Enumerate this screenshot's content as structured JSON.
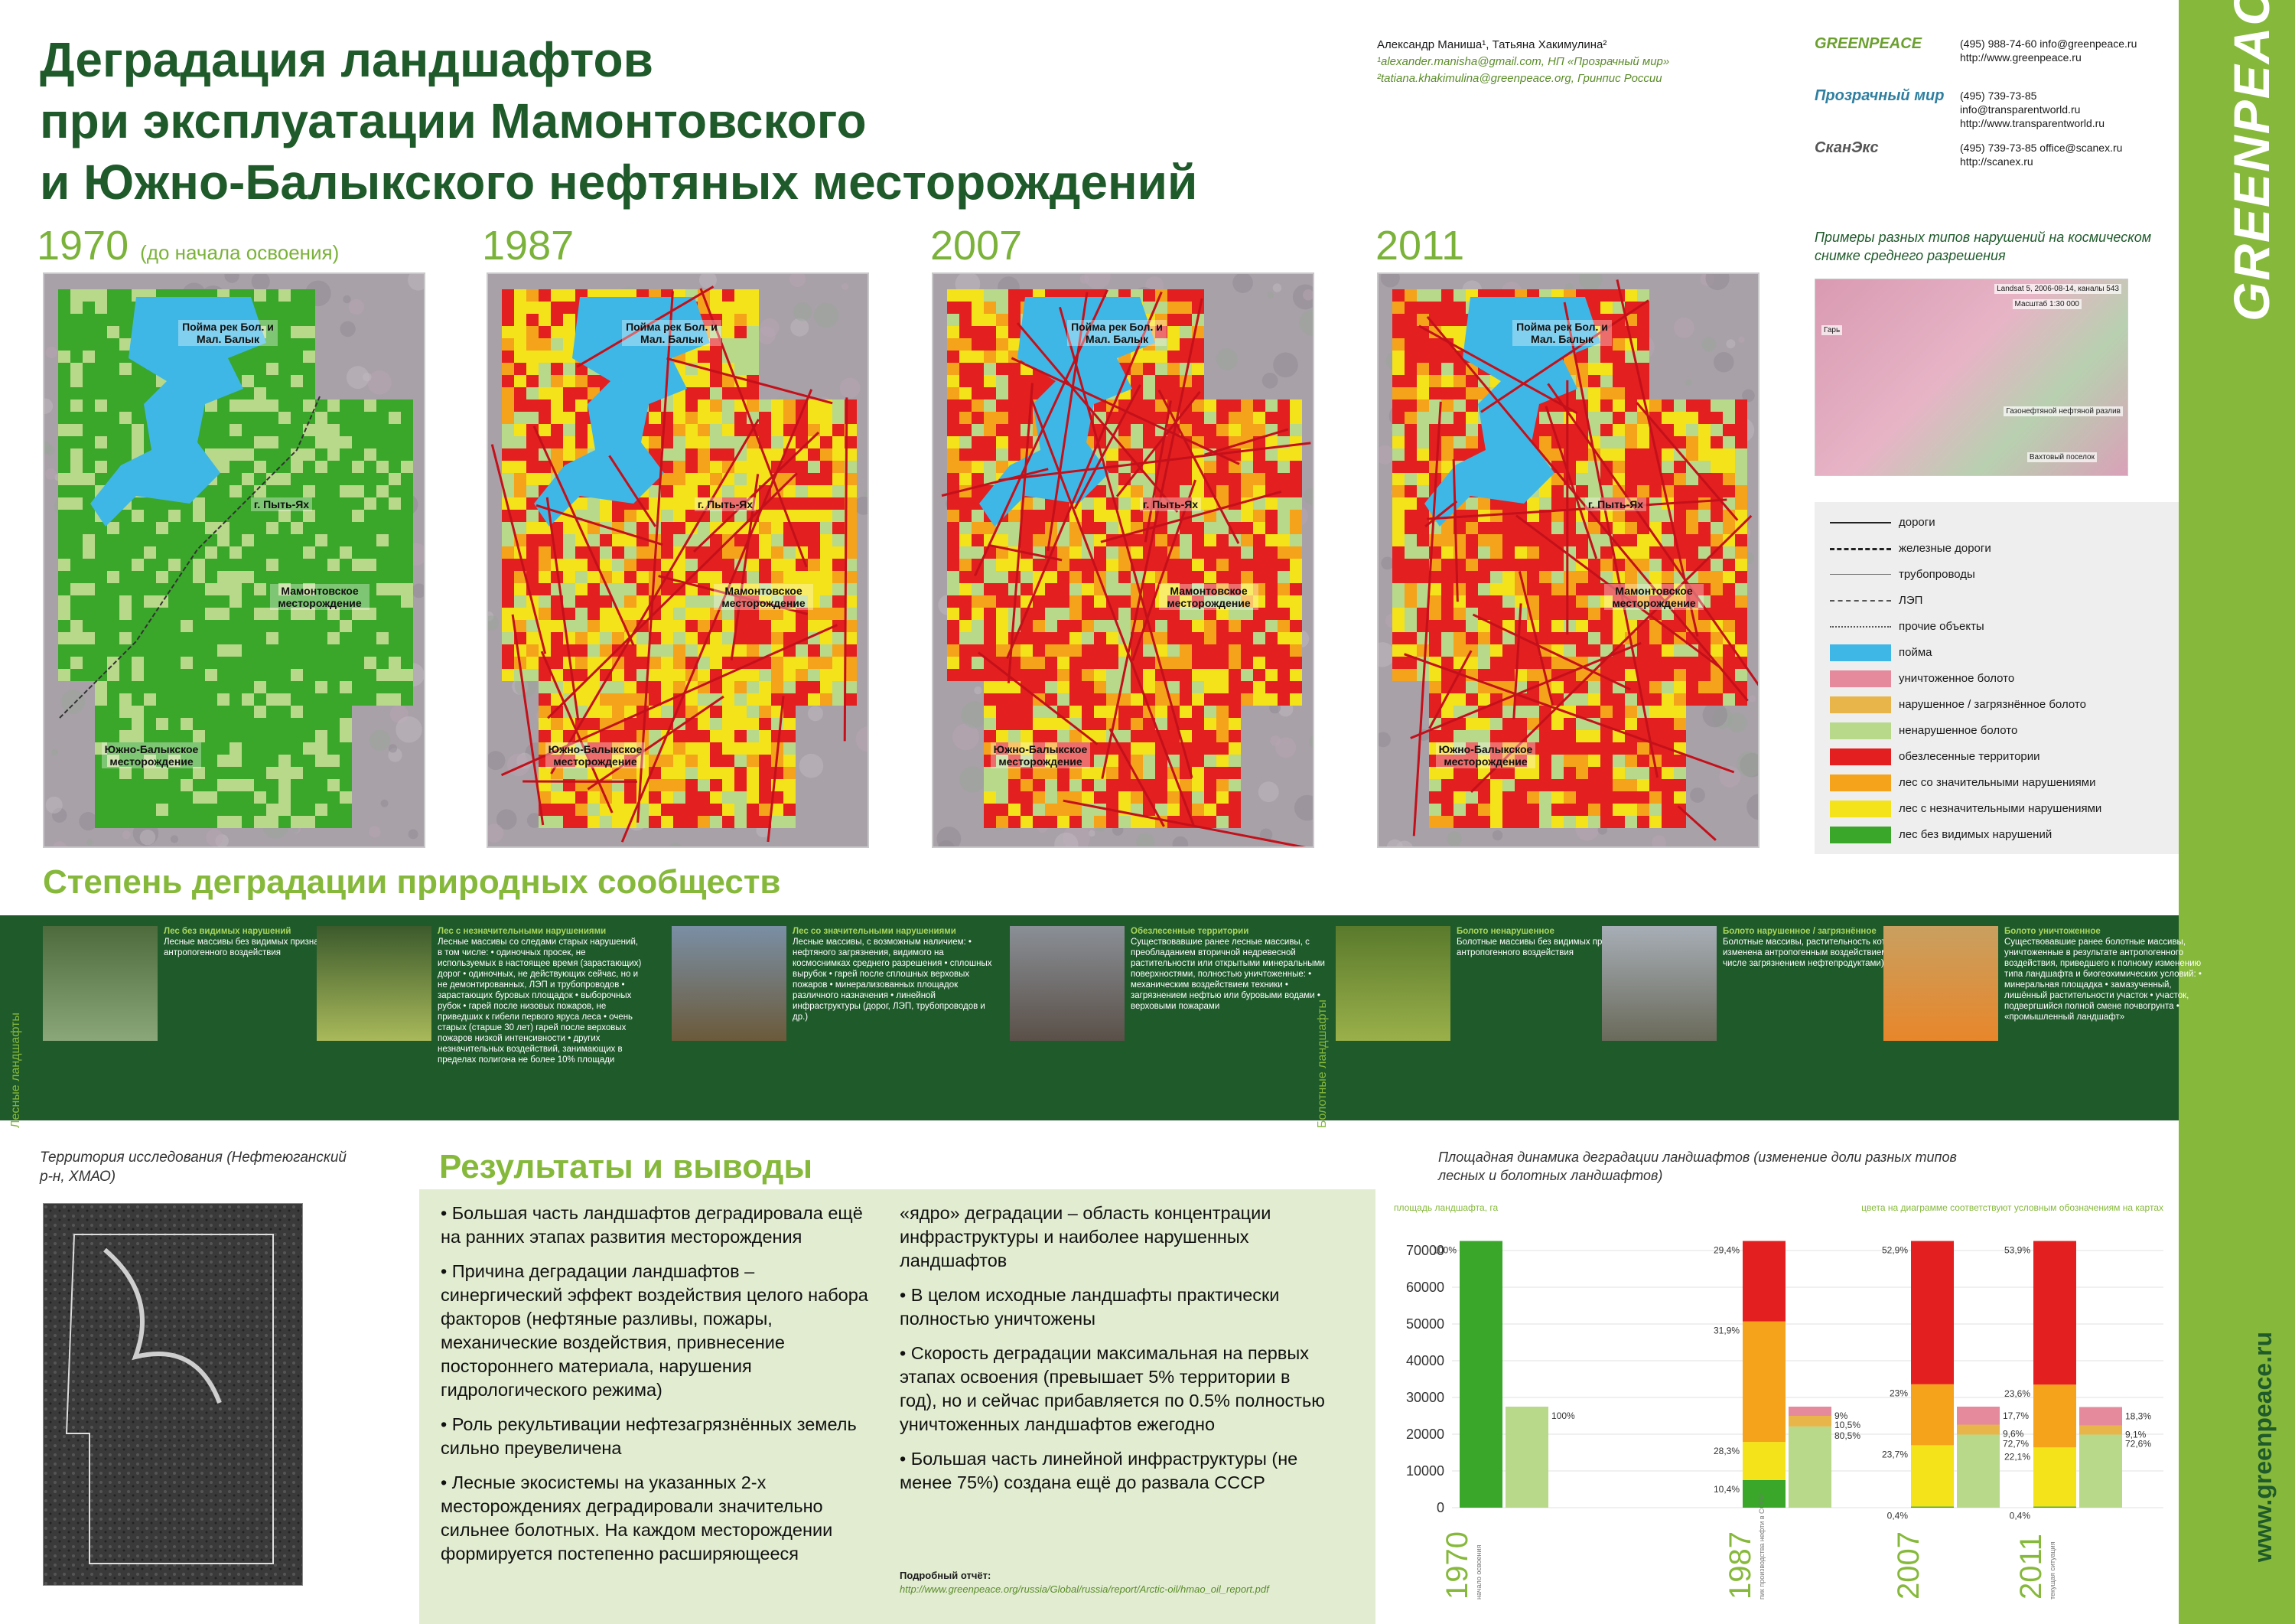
{
  "title_lines": [
    "Деградация ландшафтов",
    "при эксплуатации Мамонтовского",
    "и Южно-Балыкского нефтяных месторождений"
  ],
  "authors": {
    "names": "Александр Маниша¹, Татьяна Хакимулина²",
    "line1": "¹alexander.manisha@gmail.com, НП «Прозрачный мир»",
    "line2": "²tatiana.khakimulina@greenpeace.org, Гринпис России"
  },
  "contacts": [
    {
      "logo": "GREENPEACE",
      "lines": [
        "(495) 988-74-60   info@greenpeace.ru",
        "http://www.greenpeace.ru"
      ],
      "color": "#6ba02f"
    },
    {
      "logo": "Прозрачный мир",
      "lines": [
        "(495) 739-73-85",
        "info@transparentworld.ru",
        "http://www.transparentworld.ru"
      ],
      "color": "#2f7fa0"
    },
    {
      "logo": "СканЭкс",
      "lines": [
        "(495) 739-73-85   office@scanex.ru",
        "http://scanex.ru"
      ],
      "color": "#555555"
    }
  ],
  "side": {
    "brand": "GREENPEACE",
    "url": "www.greenpeace.ru"
  },
  "maps": [
    {
      "year": "1970",
      "note": "(до начала освоения)"
    },
    {
      "year": "1987",
      "note": ""
    },
    {
      "year": "2007",
      "note": ""
    },
    {
      "year": "2011",
      "note": ""
    }
  ],
  "map_labels": {
    "poyma": "Пойма рек Бол. и Мал. Балык",
    "pyt_yah": "г. Пыть-Ях",
    "mamont": "Мамонтовское месторождение",
    "yuzhno": "Южно-Балыкское месторождение"
  },
  "example": {
    "caption": "Примеры разных типов нарушений на космическом снимке среднего разрешения",
    "labels": [
      "Landsat 5, 2006-08-14, каналы 543",
      "Масштаб 1:30 000",
      "Гарь",
      "Газонефтяной нефтяной разлив",
      "Вахтовый поселок"
    ]
  },
  "legend": [
    {
      "type": "line",
      "style": "solid",
      "label": "дороги"
    },
    {
      "type": "line",
      "style": "rail",
      "label": "железные дороги"
    },
    {
      "type": "line",
      "style": "thin",
      "label": "трубопроводы"
    },
    {
      "type": "line",
      "style": "dashdot",
      "label": "ЛЭП"
    },
    {
      "type": "line",
      "style": "dotted",
      "label": "прочие объекты"
    },
    {
      "type": "fill",
      "color": "#3fb7e6",
      "label": "пойма"
    },
    {
      "type": "fill",
      "color": "#e58a9c",
      "label": "уничтоженное болото"
    },
    {
      "type": "fill",
      "color": "#e8b54a",
      "label": "нарушенное / загрязнённое болото"
    },
    {
      "type": "fill",
      "color": "#b8d88a",
      "label": "ненарушенное болото"
    },
    {
      "type": "fill",
      "color": "#e41f1f",
      "label": "обезлесенные территории"
    },
    {
      "type": "fill",
      "color": "#f4a31a",
      "label": "лес со значительными нарушениями"
    },
    {
      "type": "fill",
      "color": "#f4e21a",
      "label": "лес с незначительными нарушениями"
    },
    {
      "type": "fill",
      "color": "#3aa62a",
      "label": "лес без видимых нарушений"
    }
  ],
  "degradation_title": "Степень деградации природных сообществ",
  "band_groups": [
    "Лесные ландшафты",
    "Болотные ландшафты"
  ],
  "cards": [
    {
      "head": "Лес без видимых нарушений",
      "text": "Лесные массивы без видимых признаков антропогенного воздействия",
      "photo": [
        "#4d6b3c",
        "#8aa77a"
      ]
    },
    {
      "head": "Лес с незначительными нарушениями",
      "text": "Лесные массивы со следами старых нарушений, в том числе: • одиночных просек, не используемых в настоящее время (зарастающих) дорог • одиночных, не действующих сейчас, но и не демонтированных, ЛЭП и трубопроводов • зарастающих буровых площадок • выборочных рубок • гарей после низовых пожаров, не приведших к гибели первого яруса леса • очень старых (старше 30 лет) гарей после верховых пожаров низкой интенсивности • других незначительных воздействий, занимающих в пределах полигона не более 10% площади",
      "photo": [
        "#3c5a2c",
        "#a9b95a"
      ]
    },
    {
      "head": "Лес со значительными нарушениями",
      "text": "Лесные массивы, с возможным наличием: • нефтяного загрязнения, видимого на космоснимках среднего разрешения • сплошных вырубок • гарей после сплошных верховых пожаров • минерализованных площадок различного назначения • линейной инфраструктуры (дорог, ЛЭП, трубопроводов и др.)",
      "photo": [
        "#7a8fa5",
        "#6b5a3a"
      ]
    },
    {
      "head": "Обезлесенные территории",
      "text": "Существовавшие ранее лесные массивы, с преобладанием вторичной недревесной растительности или открытыми минеральными поверхностями, полностью уничтоженные: • механическим воздействием техники • загрязнением нефтью или буровыми водами • верховыми пожарами",
      "photo": [
        "#8a8f96",
        "#5a5048"
      ]
    },
    {
      "head": "Болото ненарушенное",
      "text": "Болотные массивы без видимых признаков антропогенного воздействия",
      "photo": [
        "#5a7a2c",
        "#9ab04a"
      ]
    },
    {
      "head": "Болото нарушенное / загрязнённое",
      "text": "Болотные массивы, растительность которых изменена антропогенным воздействием (в том числе загрязнением нефтепродуктами)",
      "photo": [
        "#a7aeb6",
        "#6a6a5a"
      ]
    },
    {
      "head": "Болото уничтоженное",
      "text": "Существовавшие ранее болотные массивы, уничтоженные в результате антропогенного воздействия, приведшего к полному изменению типа ландшафта и биогеохимических условий: • минеральная площадка • замазученный, лишённый растительности участок • участок, подвергшийся полной смене почвогрунта • «промышленный ландшафт»",
      "photo": [
        "#c9a060",
        "#e8862a"
      ]
    }
  ],
  "territory_caption": "Территория исследования (Нефтеюганский р-н, ХМАО)",
  "results_title": "Результаты и выводы",
  "results_left": [
    "• Большая часть ландшафтов деградировала ещё на ранних этапах развития месторождения",
    "• Причина деградации ландшафтов – синергический эффект воздействия целого набора факторов (нефтяные разливы, пожары, механические воздействия, привнесение постороннего материала, нарушения гидрологического режима)",
    "• Роль рекультивации нефтезагрязнённых земель сильно преувеличена",
    "• Лесные экосистемы на указанных 2-х месторождениях деградировали значительно сильнее болотных. На каждом месторождении формируется постепенно расширяющееся"
  ],
  "results_right": [
    "«ядро» деградации – область концентрации инфраструктуры и наиболее нарушенных ландшафтов",
    "• В целом исходные ландшафты практически полностью уничтожены",
    "• Скорость деградации максимальная на первых этапах освоения (превышает 5% территории в год), но и сейчас прибавляется по 0.5% полностью уничтоженных ландшафтов ежегодно",
    "• Большая часть линейной инфраструктуры (не менее 75%) создана ещё до развала СССР"
  ],
  "report": {
    "head": "Подробный отчёт:",
    "link": "http://www.greenpeace.org/russia/Global/russia/report/Arctic-oil/hmao_oil_report.pdf"
  },
  "chart_caption": "Площадная динамика деградации ландшафтов (изменение доли разных типов лесных и болотных ландшафтов)",
  "chart_data": {
    "type": "bar",
    "ylabel": "площадь ландшафта, га",
    "note": "цвета на диаграмме соответствуют условным обозначениям на картах",
    "ylim": [
      0,
      75000
    ],
    "yticks": [
      0,
      10000,
      20000,
      30000,
      40000,
      50000,
      60000,
      70000
    ],
    "colors": {
      "forest_ok": "#3aa62a",
      "forest_minor": "#f4e21a",
      "forest_major": "#f4a31a",
      "deforested": "#e41f1f",
      "bog_ok": "#b8d88a",
      "bog_disturbed": "#e8b54a",
      "bog_destroyed": "#e58a9c"
    },
    "groups": [
      {
        "year": "1970",
        "sublabel": "начало освоения",
        "forest": [
          {
            "key": "forest_ok",
            "value": 72600,
            "pct": "100%"
          }
        ],
        "bog": [
          {
            "key": "bog_ok",
            "value": 27500,
            "pct": "100%"
          }
        ]
      },
      {
        "year": "1987",
        "sublabel": "пик производства нефти в СССР",
        "forest": [
          {
            "key": "forest_ok",
            "value": 7500,
            "pct": "10,4%"
          },
          {
            "key": "forest_minor",
            "value": 10400,
            "pct": "28,3%"
          },
          {
            "key": "forest_major",
            "value": 32800,
            "pct": "31,9%"
          },
          {
            "key": "deforested",
            "value": 21900,
            "pct": "29,4%"
          }
        ],
        "bog": [
          {
            "key": "bog_ok",
            "value": 22100,
            "pct": "80,5%"
          },
          {
            "key": "bog_disturbed",
            "value": 2900,
            "pct": "10,5%"
          },
          {
            "key": "bog_destroyed",
            "value": 2500,
            "pct": "9%"
          }
        ]
      },
      {
        "year": "2007",
        "sublabel": "",
        "forest": [
          {
            "key": "forest_ok",
            "value": 300,
            "pct": "0,4%"
          },
          {
            "key": "forest_minor",
            "value": 16700,
            "pct": "23,7%"
          },
          {
            "key": "forest_major",
            "value": 16600,
            "pct": "23%"
          },
          {
            "key": "deforested",
            "value": 39000,
            "pct": "52,9%"
          }
        ],
        "bog": [
          {
            "key": "bog_ok",
            "value": 19900,
            "pct": "72,7%"
          },
          {
            "key": "bog_disturbed",
            "value": 2700,
            "pct": "9,6%"
          },
          {
            "key": "bog_destroyed",
            "value": 4900,
            "pct": "17,7%"
          }
        ]
      },
      {
        "year": "2011",
        "sublabel": "текущая ситуация",
        "forest": [
          {
            "key": "forest_ok",
            "value": 300,
            "pct": "0,4%"
          },
          {
            "key": "forest_minor",
            "value": 16100,
            "pct": "22,1%"
          },
          {
            "key": "forest_major",
            "value": 17100,
            "pct": "23,6%"
          },
          {
            "key": "deforested",
            "value": 39100,
            "pct": "53,9%"
          }
        ],
        "bog": [
          {
            "key": "bog_ok",
            "value": 19900,
            "pct": "72,6%"
          },
          {
            "key": "bog_disturbed",
            "value": 2500,
            "pct": "9,1%"
          },
          {
            "key": "bog_destroyed",
            "value": 5000,
            "pct": "18,3%"
          }
        ]
      }
    ]
  }
}
